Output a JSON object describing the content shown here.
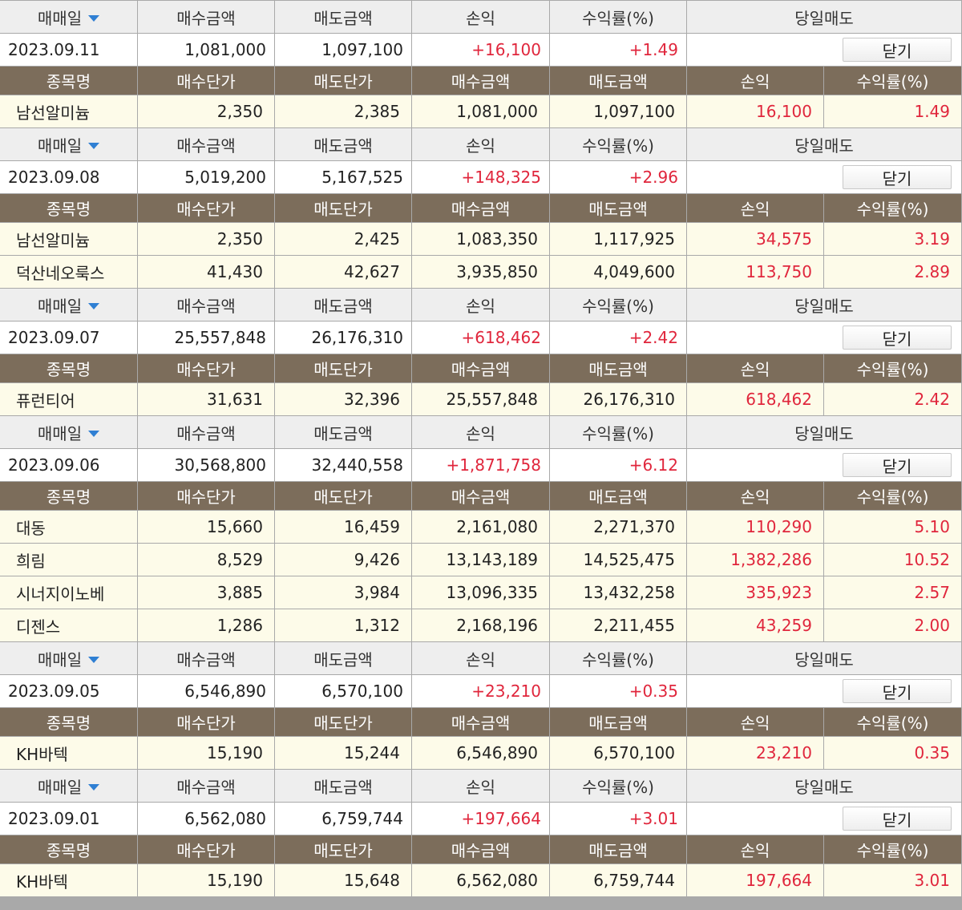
{
  "labels": {
    "trade_date": "매매일",
    "buy_amount": "매수금액",
    "sell_amount": "매도금액",
    "profit": "손익",
    "rate": "수익률(%)",
    "same_day_sell": "당일매도",
    "close": "닫기",
    "stock_name": "종목명",
    "buy_price": "매수단가",
    "sell_price": "매도단가"
  },
  "groups": [
    {
      "date": "2023.09.11",
      "buy_amount": "1,081,000",
      "sell_amount": "1,097,100",
      "profit": "+16,100",
      "rate": "+1.49",
      "rows": [
        {
          "name": "남선알미늄",
          "buy_price": "2,350",
          "sell_price": "2,385",
          "buy_amount": "1,081,000",
          "sell_amount": "1,097,100",
          "profit": "16,100",
          "rate": "1.49"
        }
      ]
    },
    {
      "date": "2023.09.08",
      "buy_amount": "5,019,200",
      "sell_amount": "5,167,525",
      "profit": "+148,325",
      "rate": "+2.96",
      "rows": [
        {
          "name": "남선알미늄",
          "buy_price": "2,350",
          "sell_price": "2,425",
          "buy_amount": "1,083,350",
          "sell_amount": "1,117,925",
          "profit": "34,575",
          "rate": "3.19"
        },
        {
          "name": "덕산네오룩스",
          "buy_price": "41,430",
          "sell_price": "42,627",
          "buy_amount": "3,935,850",
          "sell_amount": "4,049,600",
          "profit": "113,750",
          "rate": "2.89"
        }
      ]
    },
    {
      "date": "2023.09.07",
      "buy_amount": "25,557,848",
      "sell_amount": "26,176,310",
      "profit": "+618,462",
      "rate": "+2.42",
      "rows": [
        {
          "name": "퓨런티어",
          "buy_price": "31,631",
          "sell_price": "32,396",
          "buy_amount": "25,557,848",
          "sell_amount": "26,176,310",
          "profit": "618,462",
          "rate": "2.42"
        }
      ]
    },
    {
      "date": "2023.09.06",
      "buy_amount": "30,568,800",
      "sell_amount": "32,440,558",
      "profit": "+1,871,758",
      "rate": "+6.12",
      "rows": [
        {
          "name": "대동",
          "buy_price": "15,660",
          "sell_price": "16,459",
          "buy_amount": "2,161,080",
          "sell_amount": "2,271,370",
          "profit": "110,290",
          "rate": "5.10"
        },
        {
          "name": "희림",
          "buy_price": "8,529",
          "sell_price": "9,426",
          "buy_amount": "13,143,189",
          "sell_amount": "14,525,475",
          "profit": "1,382,286",
          "rate": "10.52"
        },
        {
          "name": "시너지이노베",
          "buy_price": "3,885",
          "sell_price": "3,984",
          "buy_amount": "13,096,335",
          "sell_amount": "13,432,258",
          "profit": "335,923",
          "rate": "2.57"
        },
        {
          "name": "디젠스",
          "buy_price": "1,286",
          "sell_price": "1,312",
          "buy_amount": "2,168,196",
          "sell_amount": "2,211,455",
          "profit": "43,259",
          "rate": "2.00"
        }
      ]
    },
    {
      "date": "2023.09.05",
      "buy_amount": "6,546,890",
      "sell_amount": "6,570,100",
      "profit": "+23,210",
      "rate": "+0.35",
      "rows": [
        {
          "name": "KH바텍",
          "buy_price": "15,190",
          "sell_price": "15,244",
          "buy_amount": "6,546,890",
          "sell_amount": "6,570,100",
          "profit": "23,210",
          "rate": "0.35"
        }
      ]
    },
    {
      "date": "2023.09.01",
      "buy_amount": "6,562,080",
      "sell_amount": "6,759,744",
      "profit": "+197,664",
      "rate": "+3.01",
      "rows": [
        {
          "name": "KH바텍",
          "buy_price": "15,190",
          "sell_price": "15,648",
          "buy_amount": "6,562,080",
          "sell_amount": "6,759,744",
          "profit": "197,664",
          "rate": "3.01"
        }
      ]
    }
  ],
  "colors": {
    "detail_header_bg": "#7c6d5b",
    "summary_header_bg": "#eeeeee",
    "detail_row_bg": "#fdfbe9",
    "profit_red": "#e0263c",
    "sort_arrow_blue": "#2f7fd3"
  },
  "icons": {
    "sort": "sort-down-arrow-icon"
  }
}
